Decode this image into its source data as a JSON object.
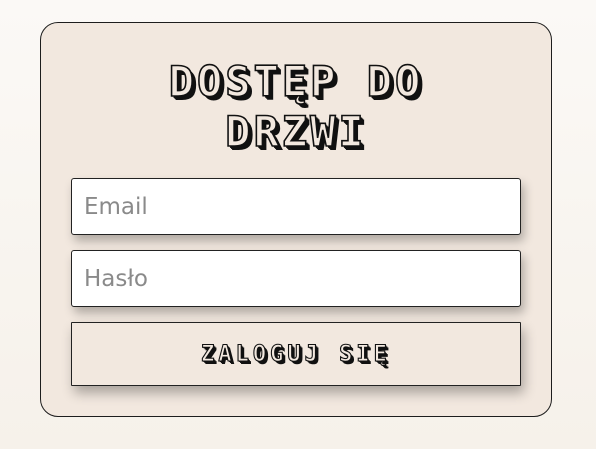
{
  "login": {
    "title": "DOSTĘP DO DRZWI",
    "email_placeholder": "Email",
    "email_value": "",
    "password_placeholder": "Hasło",
    "password_value": "",
    "submit_label": "ZALOGUJ SIĘ"
  },
  "colors": {
    "background": "#f6f1ea",
    "card": "#f2e8df",
    "border": "#1d1d1d",
    "input_background": "#ffffff"
  }
}
